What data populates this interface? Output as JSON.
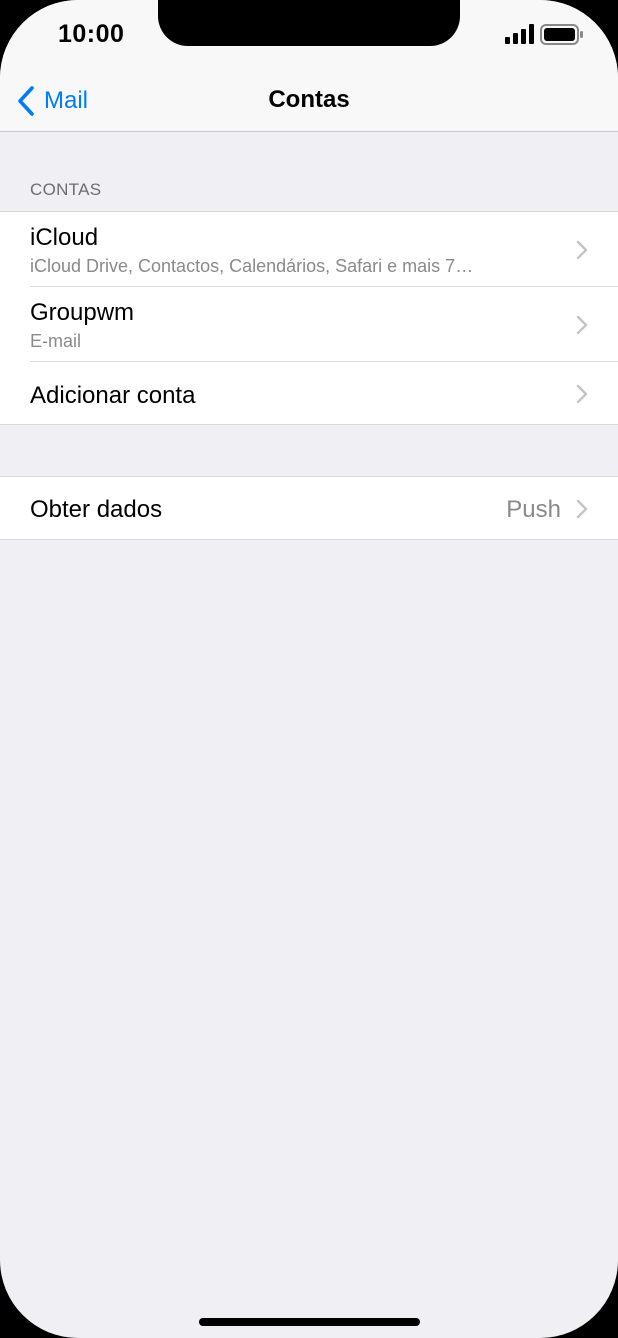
{
  "status_bar": {
    "time": "10:00"
  },
  "nav": {
    "back_label": "Mail",
    "title": "Contas"
  },
  "accounts_section": {
    "header": "CONTAS",
    "items": [
      {
        "title": "iCloud",
        "subtitle": "iCloud Drive, Contactos, Calendários, Safari e mais 7…"
      },
      {
        "title": "Groupwm",
        "subtitle": "E-mail"
      },
      {
        "title": "Adicionar conta"
      }
    ]
  },
  "fetch_section": {
    "title": "Obter dados",
    "value": "Push"
  },
  "colors": {
    "accent": "#007aff",
    "background": "#efeff4",
    "secondary_text": "#8a8a8e"
  },
  "icons": [
    "signal-icon",
    "battery-icon",
    "back-chevron-icon",
    "chevron-right-icon"
  ]
}
